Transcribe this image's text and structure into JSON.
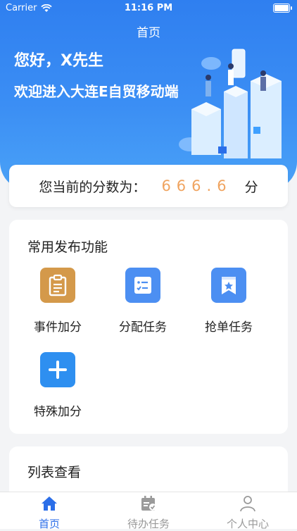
{
  "status_bar": {
    "carrier": "Carrier",
    "time": "11:16 PM"
  },
  "header": {
    "title": "首页",
    "greeting": "您好，X先生",
    "welcome": "欢迎进入大连E自贸移动端"
  },
  "score": {
    "label": "您当前的分数为：",
    "value": "666.6",
    "unit": "分"
  },
  "common_functions": {
    "title": "常用发布功能",
    "items": [
      {
        "label": "事件加分",
        "icon": "clipboard-icon",
        "color": "#d4994a"
      },
      {
        "label": "分配任务",
        "icon": "task-list-icon",
        "color": "#4c8ff2"
      },
      {
        "label": "抢单任务",
        "icon": "bookmark-star-icon",
        "color": "#4c8ff2"
      },
      {
        "label": "特殊加分",
        "icon": "plus-icon",
        "color": "#2e8ff0"
      }
    ]
  },
  "list_view": {
    "title": "列表查看"
  },
  "tabbar": {
    "tabs": [
      {
        "label": "首页",
        "icon": "home-icon",
        "active": true
      },
      {
        "label": "待办任务",
        "icon": "calendar-check-icon",
        "active": false
      },
      {
        "label": "个人中心",
        "icon": "person-icon",
        "active": false
      }
    ]
  },
  "colors": {
    "primary": "#2f7ff0",
    "score": "#f0a460",
    "tab_active": "#2b6ee8"
  }
}
